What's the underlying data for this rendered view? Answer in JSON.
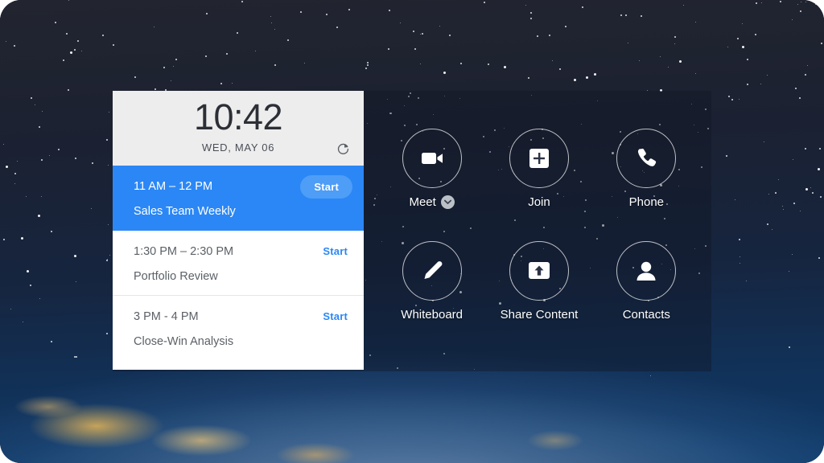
{
  "device": {
    "screen_name": "conference-room-home-screen"
  },
  "clock": {
    "time": "10:42",
    "date": "WED, MAY 06",
    "refresh_icon": "refresh-icon"
  },
  "meetings": {
    "rows": [
      {
        "time": "11 AM – 12 PM",
        "title": "Sales Team Weekly",
        "start_label": "Start",
        "active": true
      },
      {
        "time": "1:30 PM – 2:30 PM",
        "title": "Portfolio Review",
        "start_label": "Start",
        "active": false
      },
      {
        "time": "3 PM - 4 PM",
        "title": "Close-Win Analysis",
        "start_label": "Start",
        "active": false
      }
    ]
  },
  "actions": [
    {
      "label": "Meet",
      "icon": "video-camera-icon",
      "has_chevron": true
    },
    {
      "label": "Join",
      "icon": "plus-square-icon",
      "has_chevron": false
    },
    {
      "label": "Phone",
      "icon": "phone-icon",
      "has_chevron": false
    },
    {
      "label": "Whiteboard",
      "icon": "pencil-icon",
      "has_chevron": false
    },
    {
      "label": "Share Content",
      "icon": "upload-box-icon",
      "has_chevron": false
    },
    {
      "label": "Contacts",
      "icon": "person-icon",
      "has_chevron": false
    }
  ],
  "colors": {
    "accent_blue": "#2b87f5",
    "active_row_blue": "#2b87f5",
    "start_pill_blue": "#4e9df7",
    "clock_header_gray": "#ededed",
    "text_gray": "#5c6167",
    "card_white": "#ffffff"
  }
}
